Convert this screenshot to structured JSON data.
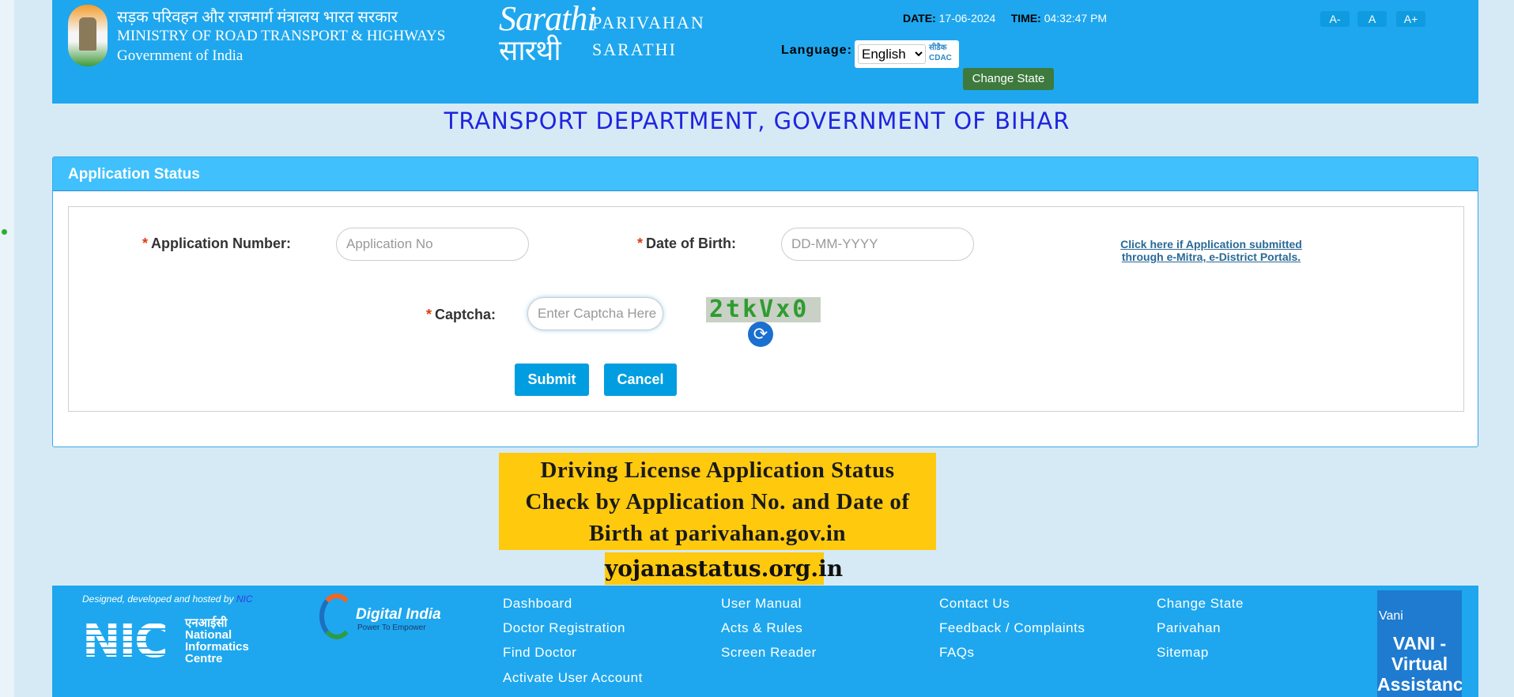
{
  "header": {
    "ministry_hindi": "सड़क परिवहन और राजमार्ग मंत्रालय भारत सरकार",
    "ministry_english": "MINISTRY OF ROAD TRANSPORT & HIGHWAYS",
    "government": "Government of India",
    "logo_script": "Sarathi",
    "logo_hindi": "सारथी",
    "brand_line1": "PARIVAHAN",
    "brand_line2": "SARATHI",
    "date_label": "DATE:",
    "date_value": "17-06-2024",
    "time_label": "TIME:",
    "time_value": "04:32:47 PM",
    "font_buttons": [
      "A-",
      "A",
      "A+"
    ],
    "language_label": "Language:",
    "language_selected": "English",
    "cdac_logo": "सीडैक CDAC",
    "change_state": "Change State",
    "color": "#1ea7ee"
  },
  "department_title": "TRANSPORT DEPARTMENT, GOVERNMENT OF BIHAR",
  "panel": {
    "title": "Application Status",
    "required_mark": "*",
    "application_number_label": "Application Number:",
    "application_number_placeholder": "Application No",
    "dob_label": "Date of Birth:",
    "dob_placeholder": "DD-MM-YYYY",
    "portal_link_line1": "Click here if Application submitted",
    "portal_link_line2": "through e-Mitra, e-District Portals.",
    "captcha_label": "Captcha:",
    "captcha_placeholder": "Enter Captcha Here",
    "captcha_text": "2tkVx0",
    "refresh_icon": "refresh-icon",
    "submit": "Submit",
    "cancel": "Cancel"
  },
  "banner": {
    "line1": "Driving License Application Status",
    "line2": "Check by Application No. and Date of",
    "line3": "Birth at parivahan.gov.in",
    "site": "yojanastatus.org.in",
    "color": "#ffc90e"
  },
  "footer": {
    "designed_by": "Designed, developed and hosted by",
    "designed_by_org": "NIC",
    "nic_logo": "NIC",
    "nic_hindi": "एनआईसी",
    "nic_name1": "National",
    "nic_name2": "Informatics",
    "nic_name3": "Centre",
    "digital_india": "Digital India",
    "digital_india_tagline": "Power To Empower",
    "columns": [
      [
        "Dashboard",
        "Doctor Registration",
        "Find Doctor",
        "Activate User Account"
      ],
      [
        "User Manual",
        "Acts & Rules",
        "Screen Reader"
      ],
      [
        "Contact Us",
        "Feedback / Complaints",
        "FAQs"
      ],
      [
        "Change State",
        "Parivahan",
        "Sitemap"
      ]
    ],
    "vani_alt": "Vani",
    "vani_text": "VANI - Virtual Assistance"
  }
}
